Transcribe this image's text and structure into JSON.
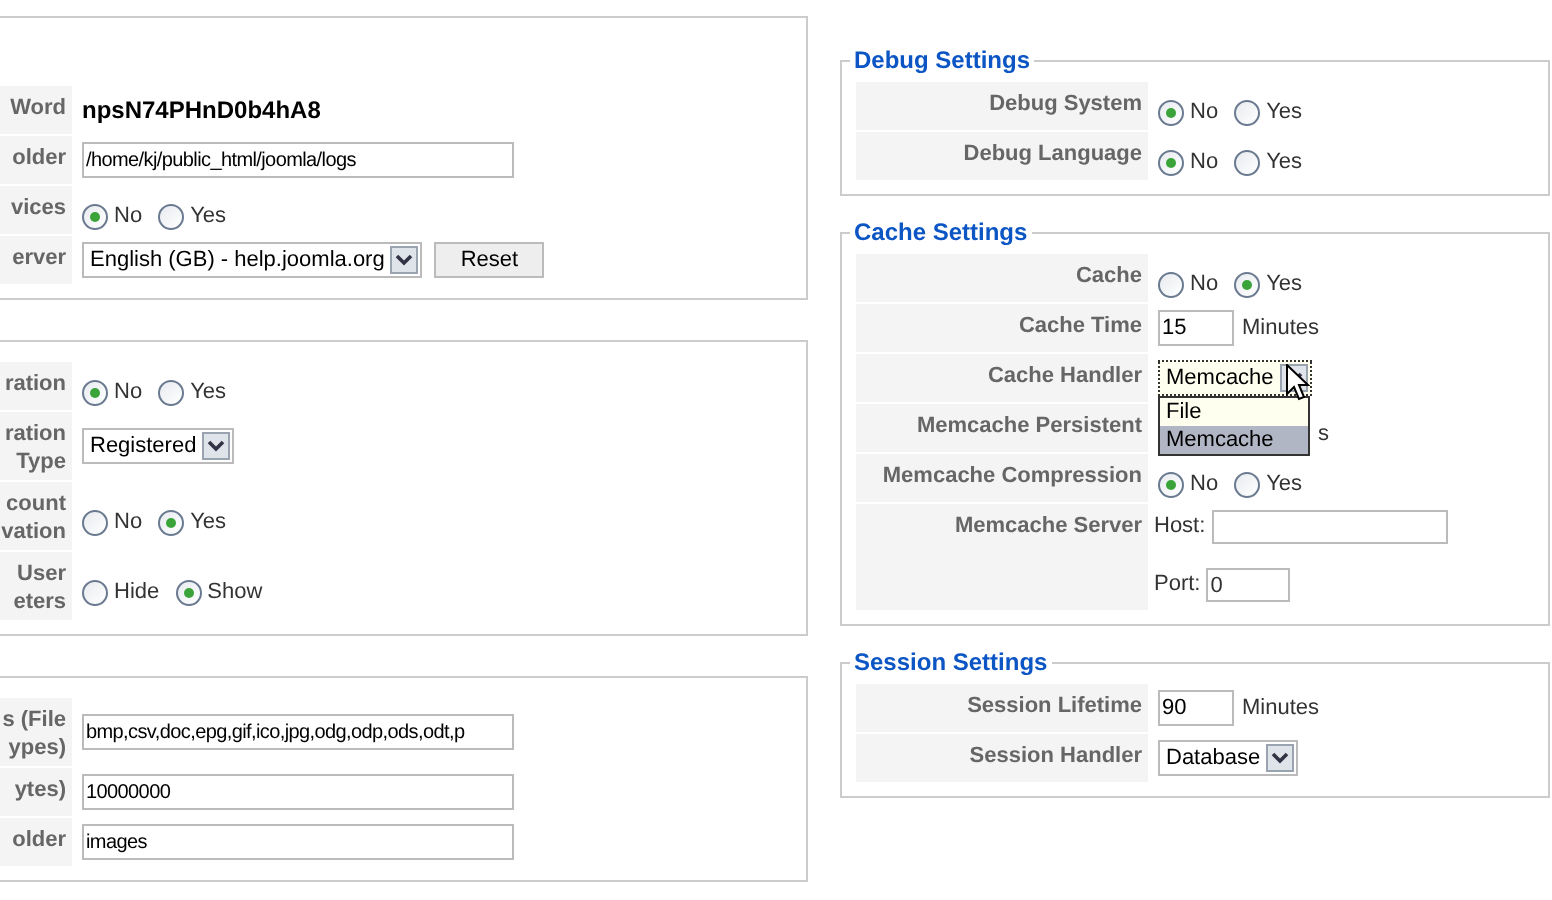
{
  "left_panels": [
    {
      "rows": [
        {
          "label": "Word",
          "kind": "text",
          "value": "npsN74PHnD0b4hA8"
        },
        {
          "label": "older",
          "kind": "input",
          "value": "/home/kj/public_html/joomla/logs"
        },
        {
          "label": "vices",
          "kind": "radio",
          "options": [
            {
              "label": "No",
              "selected": true
            },
            {
              "label": "Yes",
              "selected": false
            }
          ]
        },
        {
          "label": "erver",
          "kind": "select",
          "value": "English (GB) - help.joomla.org",
          "button": "Reset"
        }
      ]
    },
    {
      "rows": [
        {
          "label": "ration",
          "kind": "radio",
          "options": [
            {
              "label": "No",
              "selected": true
            },
            {
              "label": "Yes",
              "selected": false
            }
          ]
        },
        {
          "label": "ration Type",
          "kind": "select",
          "value": "Registered"
        },
        {
          "label": "count vation",
          "kind": "radio",
          "options": [
            {
              "label": "No",
              "selected": false
            },
            {
              "label": "Yes",
              "selected": true
            }
          ]
        },
        {
          "label": "User eters",
          "kind": "radio",
          "options": [
            {
              "label": "Hide",
              "selected": false
            },
            {
              "label": "Show",
              "selected": true
            }
          ]
        }
      ]
    },
    {
      "rows": [
        {
          "label": "s (File ypes)",
          "kind": "input",
          "value": "bmp,csv,doc,epg,gif,ico,jpg,odg,odp,ods,odt,p"
        },
        {
          "label": "ytes)",
          "kind": "input",
          "value": "10000000"
        },
        {
          "label": "older",
          "kind": "input",
          "value": "images"
        }
      ]
    }
  ],
  "right_panels": [
    {
      "title": "Debug Settings",
      "rows": [
        {
          "label": "Debug System",
          "kind": "radio",
          "options": [
            {
              "label": "No",
              "selected": true
            },
            {
              "label": "Yes",
              "selected": false
            }
          ]
        },
        {
          "label": "Debug Language",
          "kind": "radio",
          "options": [
            {
              "label": "No",
              "selected": true
            },
            {
              "label": "Yes",
              "selected": false
            }
          ]
        }
      ]
    },
    {
      "title": "Cache Settings",
      "rows": [
        {
          "label": "Cache",
          "kind": "radio",
          "options": [
            {
              "label": "No",
              "selected": false
            },
            {
              "label": "Yes",
              "selected": true
            }
          ]
        },
        {
          "label": "Cache Time",
          "kind": "input",
          "value": "15",
          "suffix": "Minutes"
        },
        {
          "label": "Cache Handler",
          "kind": "select",
          "value": "Memcache",
          "expanded": true,
          "options": [
            {
              "label": "File",
              "selected": false
            },
            {
              "label": "Memcache",
              "selected": true
            }
          ]
        },
        {
          "label": "Memcache Persistent",
          "kind": "fragment",
          "value": "s"
        },
        {
          "label": "Memcache Compression",
          "kind": "radio",
          "options": [
            {
              "label": "No",
              "selected": true
            },
            {
              "label": "Yes",
              "selected": false
            }
          ]
        },
        {
          "label": "Memcache Server",
          "kind": "hostport",
          "host_label": "Host:",
          "host_value": "",
          "port_label": "Port:",
          "port_value": "0"
        }
      ]
    },
    {
      "title": "Session Settings",
      "rows": [
        {
          "label": "Session Lifetime",
          "kind": "input",
          "value": "90",
          "suffix": "Minutes"
        },
        {
          "label": "Session Handler",
          "kind": "select",
          "value": "Database"
        }
      ]
    }
  ]
}
